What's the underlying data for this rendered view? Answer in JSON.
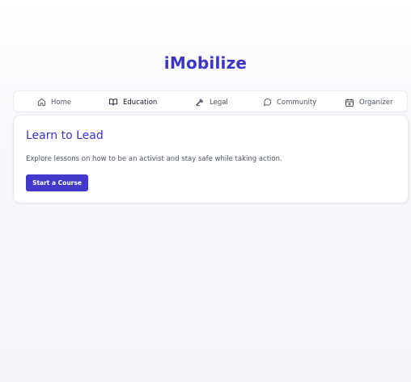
{
  "app": {
    "title": "iMobilize"
  },
  "nav": {
    "items": [
      {
        "label": "Home",
        "icon": "home-icon",
        "active": false
      },
      {
        "label": "Education",
        "icon": "book-icon",
        "active": true
      },
      {
        "label": "Legal",
        "icon": "gavel-icon",
        "active": false
      },
      {
        "label": "Community",
        "icon": "chat-bubble-icon",
        "active": false
      },
      {
        "label": "Organizer",
        "icon": "calendar-plus-icon",
        "active": false
      }
    ]
  },
  "card": {
    "title": "Learn to Lead",
    "description": "Explore lessons on how to be an activist and stay safe while taking action.",
    "button_label": "Start a Course"
  },
  "colors": {
    "brand": "#3b35c9",
    "button": "#4338ca",
    "text_muted": "#4b5563"
  }
}
